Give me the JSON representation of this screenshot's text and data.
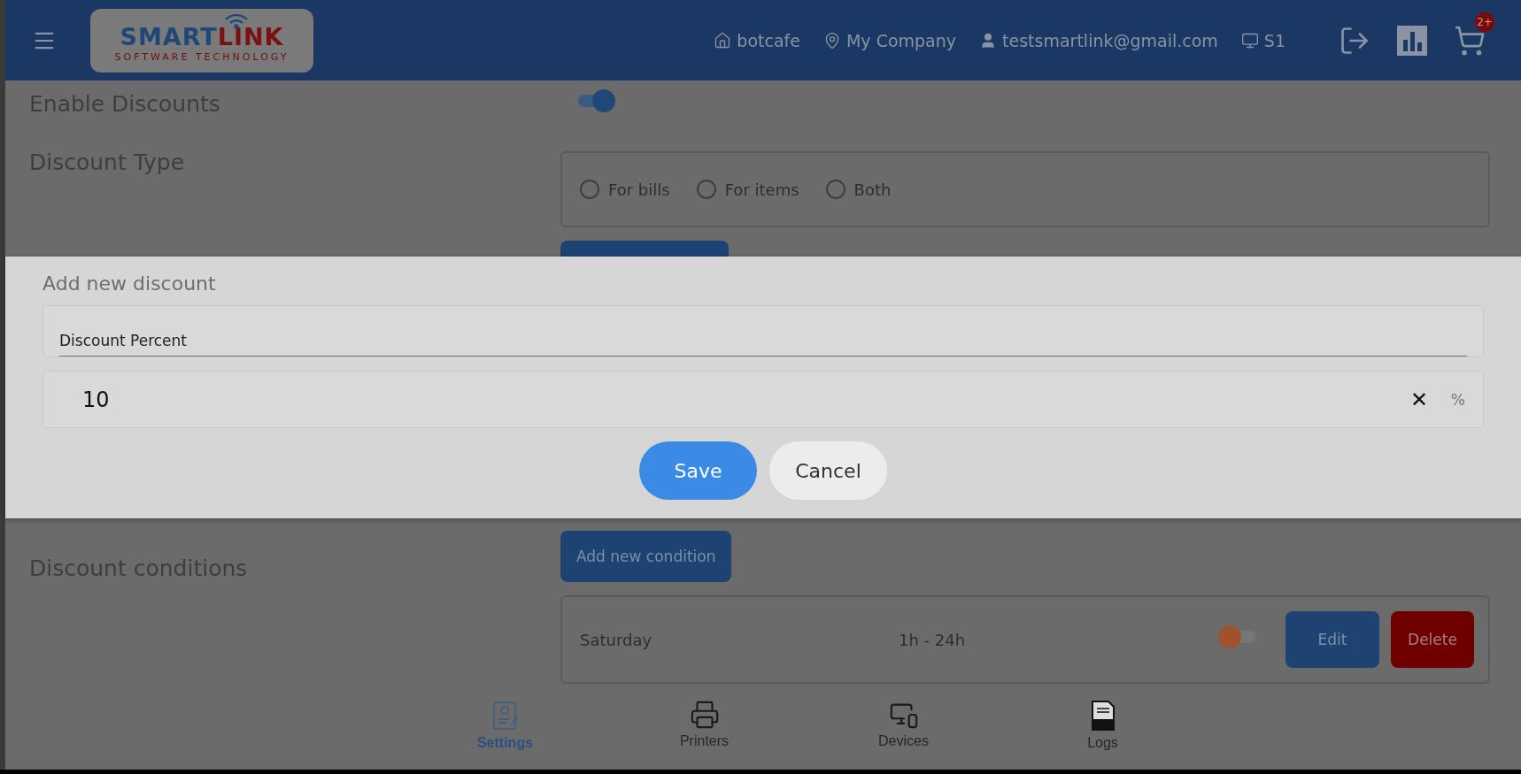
{
  "header": {
    "logo": {
      "primary": "SMART",
      "accent": "LINK",
      "tagline": "SOFTWARE TECHNOLOGY"
    },
    "info": [
      {
        "kind": "home",
        "text": "botcafe"
      },
      {
        "kind": "location",
        "text": "My Company"
      },
      {
        "kind": "user",
        "text": "testsmartlink@gmail.com"
      },
      {
        "kind": "monitor",
        "text": "S1"
      }
    ],
    "cart_badge": "2+"
  },
  "settings": {
    "enable_discounts": {
      "label": "Enable Discounts",
      "on": true
    },
    "discount_type": {
      "label": "Discount Type",
      "options": [
        {
          "label": "For bills",
          "selected": false
        },
        {
          "label": "For items",
          "selected": false
        },
        {
          "label": "Both",
          "selected": false
        }
      ]
    },
    "discount_conditions": {
      "label": "Discount conditions",
      "add_button": "Add new condition",
      "rows": [
        {
          "day": "Saturday",
          "hours": "1h - 24h",
          "on": false,
          "edit": "Edit",
          "delete": "Delete"
        }
      ]
    }
  },
  "dialog": {
    "title": "Add new discount",
    "field_label": "Discount Percent",
    "value": "10",
    "clear": "✕",
    "unit": "%",
    "save": "Save",
    "cancel": "Cancel"
  },
  "nav": [
    {
      "kind": "settings",
      "label": "Settings",
      "selected": true
    },
    {
      "kind": "printer",
      "label": "Printers",
      "selected": false
    },
    {
      "kind": "devices",
      "label": "Devices",
      "selected": false
    },
    {
      "kind": "log",
      "label": "Logs",
      "selected": false
    }
  ]
}
